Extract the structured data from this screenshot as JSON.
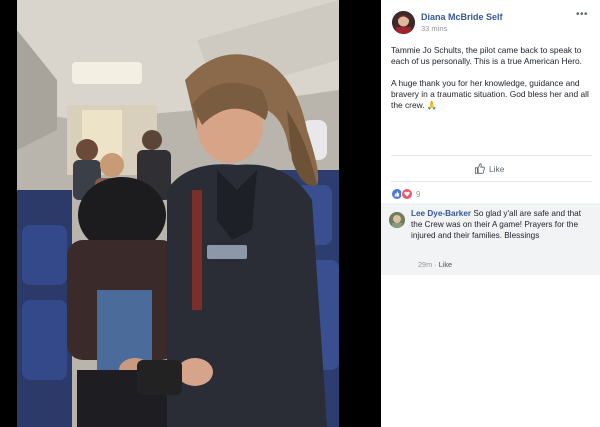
{
  "post": {
    "author": "Diana McBride Self",
    "time": "33 mins",
    "more_icon": "ellipsis-icon",
    "paragraph_1": "Tammie Jo Schults, the pilot came back to speak to each of us personally. This is a true American Hero.",
    "paragraph_2": "A huge thank you for her knowledge, guidance and bravery in a traumatic situation. God bless her and all the crew.",
    "paragraph_2_emoji": "🙏"
  },
  "actions": {
    "like_label": "Like",
    "like_icon": "thumbs-up-icon"
  },
  "reactions": {
    "count": "9",
    "icons": [
      "like-reaction-icon",
      "love-reaction-icon"
    ]
  },
  "comment": {
    "author": "Lee Dye-Barker",
    "text": "So glad y'all are safe and that the Crew was on their A game! Prayers for the injured and their families. Blessings",
    "time": "29m",
    "like_label": "Like",
    "separator": "·"
  },
  "colors": {
    "link_blue": "#365899",
    "meta_gray": "#90949c",
    "like_reaction": "#4a76e0",
    "love_reaction": "#f25268"
  }
}
